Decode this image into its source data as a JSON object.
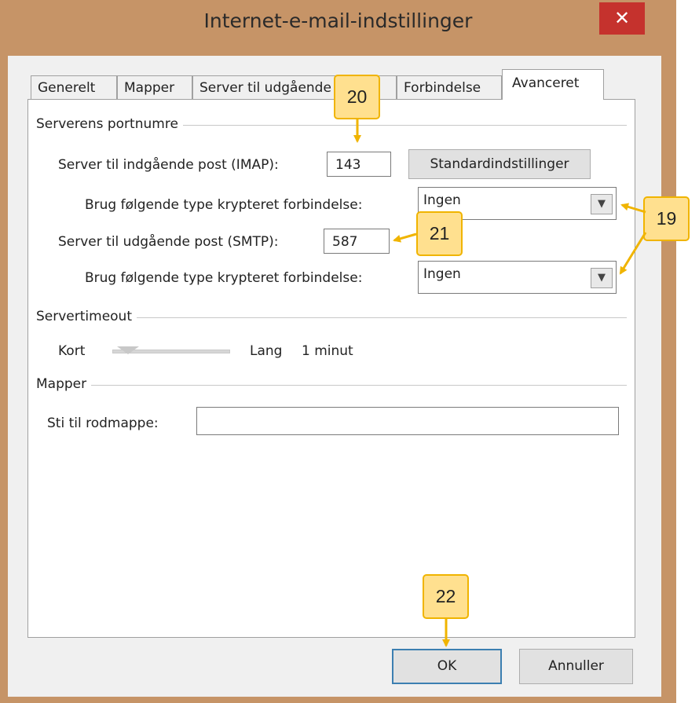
{
  "window": {
    "title": "Internet-e-mail-indstillinger",
    "close_symbol": "✕"
  },
  "tabs": [
    "Generelt",
    "Mapper",
    "Server til udgående post",
    "Forbindelse",
    "Avanceret"
  ],
  "active_tab": "Avanceret",
  "port_group": {
    "label": "Serverens portnumre",
    "imap_label": "Server til indgående post (IMAP):",
    "imap_value": "143",
    "defaults_button": "Standardindstillinger",
    "encrypt_label_1": "Brug følgende type krypteret forbindelse:",
    "encrypt_value_1": "Ingen",
    "smtp_label": "Server til udgående post (SMTP):",
    "smtp_value": "587",
    "encrypt_label_2": "Brug følgende type krypteret forbindelse:",
    "encrypt_value_2": "Ingen"
  },
  "timeout_group": {
    "label": "Servertimeout",
    "short": "Kort",
    "long": "Lang",
    "value_text": "1 minut",
    "slider_fraction": 0.1
  },
  "folders_group": {
    "label": "Mapper",
    "root_label": "Sti til rodmappe:",
    "root_value": ""
  },
  "buttons": {
    "ok": "OK",
    "cancel": "Annuller"
  },
  "callouts": {
    "c19": "19",
    "c20": "20",
    "c21": "21",
    "c22": "22"
  },
  "colors": {
    "frame": "#c69467",
    "close": "#c5322d",
    "callout_fill": "#ffe08f",
    "callout_border": "#f0b400"
  }
}
